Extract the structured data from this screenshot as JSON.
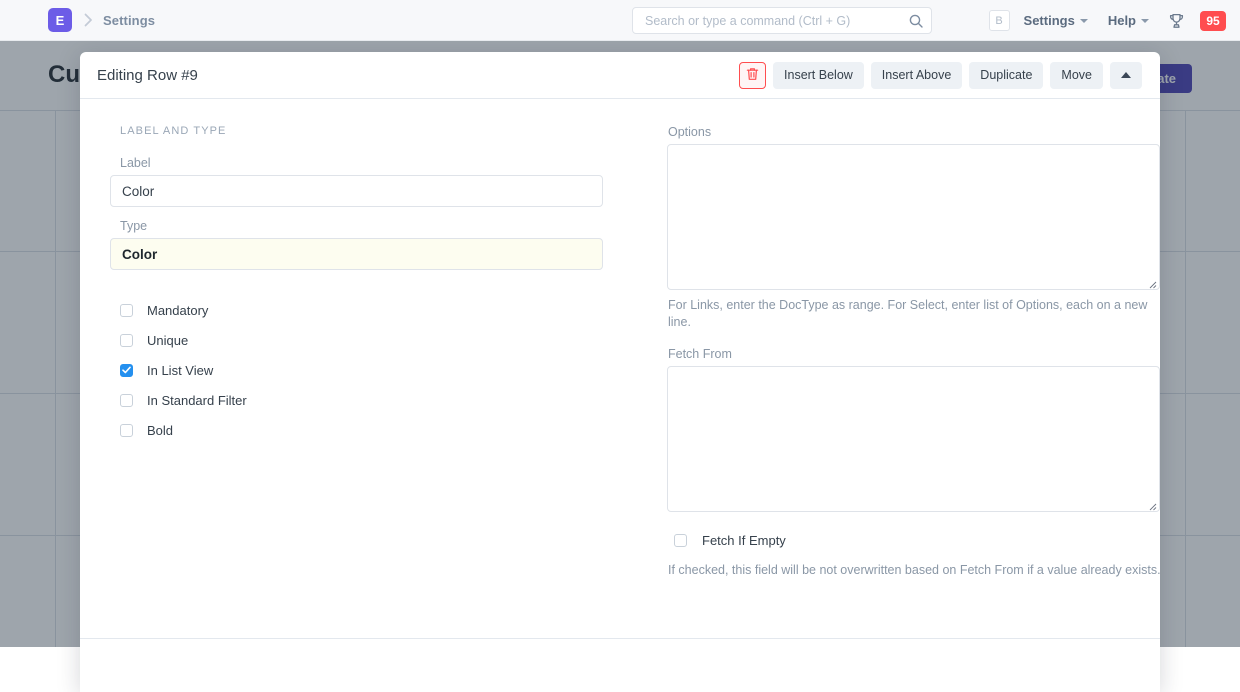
{
  "navbar": {
    "logo_letter": "E",
    "breadcrumb": "Settings",
    "search": {
      "placeholder": "Search or type a command (Ctrl + G)",
      "value": ""
    },
    "avatar_letter": "B",
    "settings_label": "Settings",
    "help_label": "Help",
    "notification_count": "95"
  },
  "page": {
    "title": "Customize Form",
    "update_label": "Update"
  },
  "modal": {
    "title": "Editing Row #9",
    "actions": {
      "delete": "Delete",
      "insert_below": "Insert Below",
      "insert_above": "Insert Above",
      "duplicate": "Duplicate",
      "move": "Move",
      "collapse": "Collapse"
    },
    "section_label": "LABEL AND TYPE",
    "fields": {
      "label": {
        "label": "Label",
        "value": "Color"
      },
      "type": {
        "label": "Type",
        "value": "Color"
      },
      "options": {
        "label": "Options",
        "value": "",
        "help": "For Links, enter the DocType as range. For Select, enter list of Options, each on a new line."
      },
      "fetch_from": {
        "label": "Fetch From",
        "value": ""
      },
      "fetch_if_empty": {
        "label": "Fetch If Empty",
        "checked": false,
        "help": "If checked, this field will be not overwritten based on Fetch From if a value already exists."
      }
    },
    "checkboxes": [
      {
        "label": "Mandatory",
        "checked": false
      },
      {
        "label": "Unique",
        "checked": false
      },
      {
        "label": "In List View",
        "checked": true
      },
      {
        "label": "In Standard Filter",
        "checked": false
      },
      {
        "label": "Bold",
        "checked": false
      }
    ]
  },
  "colors": {
    "brand": "#6c5ce7",
    "primary_button": "#4a3fb5",
    "danger": "#ff4d4f",
    "checkbox_checked": "#2490ef",
    "highlight_field": "#fdfdf0"
  }
}
